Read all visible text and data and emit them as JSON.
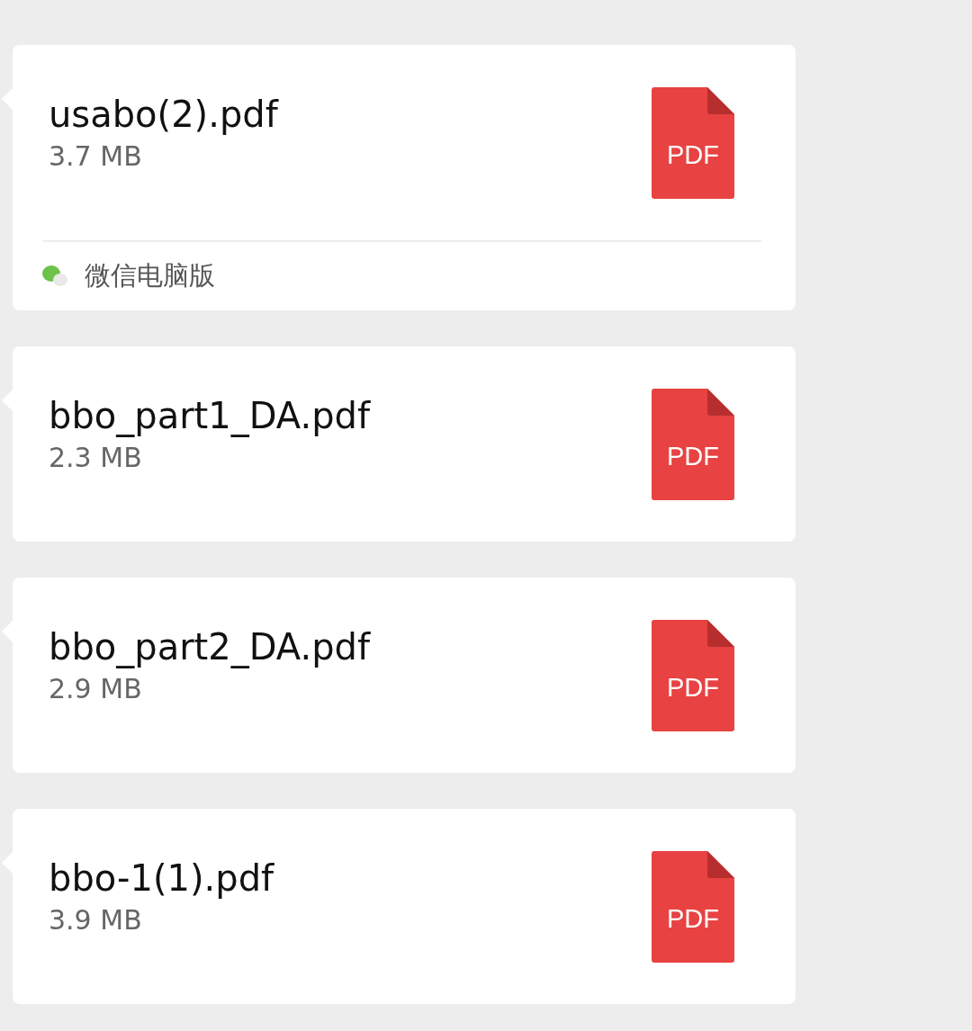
{
  "messages": [
    {
      "file_name": "usabo(2).pdf",
      "size": "3.7 MB",
      "icon_label": "PDF",
      "source": "微信电脑版"
    },
    {
      "file_name": "bbo_part1_DA.pdf",
      "size": "2.3 MB",
      "icon_label": "PDF"
    },
    {
      "file_name": "bbo_part2_DA.pdf",
      "size": "2.9 MB",
      "icon_label": "PDF"
    },
    {
      "file_name": "bbo-1(1).pdf",
      "size": "3.9 MB",
      "icon_label": "PDF"
    }
  ]
}
